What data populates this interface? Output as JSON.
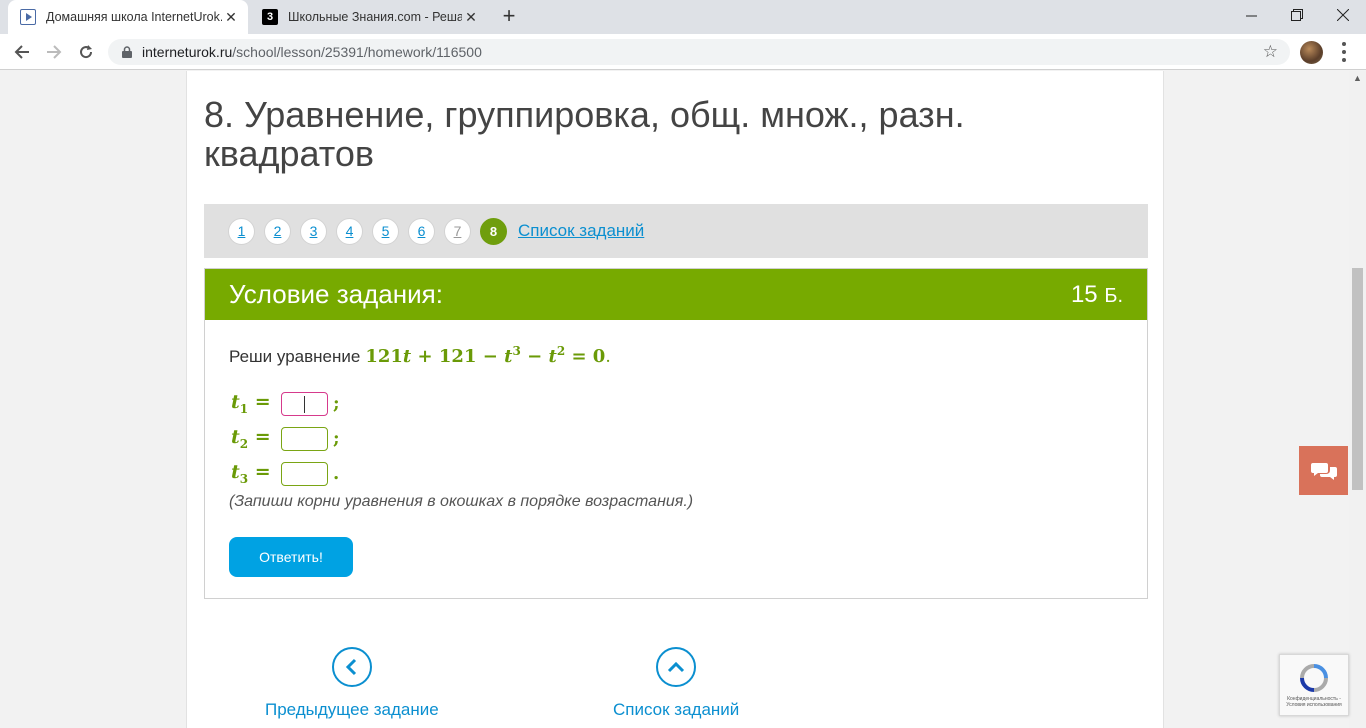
{
  "browser": {
    "tabs": [
      {
        "title": "Домашняя школа InternetUrok.r",
        "active": true
      },
      {
        "title": "Школьные Знания.com - Решае",
        "active": false
      }
    ],
    "url_host": "interneturok.ru",
    "url_path": "/school/lesson/25391/homework/116500"
  },
  "page": {
    "title": "8. Уравнение, группировка, общ. множ., разн. квадратов",
    "pager": {
      "pages": [
        "1",
        "2",
        "3",
        "4",
        "5",
        "6",
        "7",
        "8"
      ],
      "current": "8",
      "list_link": "Список заданий"
    },
    "task": {
      "header": "Условие задания:",
      "points": "15",
      "points_unit": "Б.",
      "prompt": "Реши уравнение",
      "equation": {
        "a": "121",
        "v": "t",
        "plus": "+",
        "b": "121",
        "minus": "−",
        "exp3": "3",
        "exp2": "2",
        "rhs": "= 0"
      },
      "period": ".",
      "answers": [
        {
          "var": "t",
          "sub": "1",
          "value": "",
          "sep": ";"
        },
        {
          "var": "t",
          "sub": "2",
          "value": "",
          "sep": ";"
        },
        {
          "var": "t",
          "sub": "3",
          "value": "",
          "sep": "."
        }
      ],
      "hint": "(Запиши корни уравнения в окошках в порядке возрастания.)",
      "submit_label": "Ответить!"
    },
    "nav": {
      "prev_label": "Предыдущее задание",
      "list_label": "Список заданий"
    }
  },
  "colors": {
    "accent_green": "#77aa00",
    "link_blue": "#0b8fd0",
    "button_blue": "#00a2e3",
    "chat_orange": "#d9725a"
  }
}
